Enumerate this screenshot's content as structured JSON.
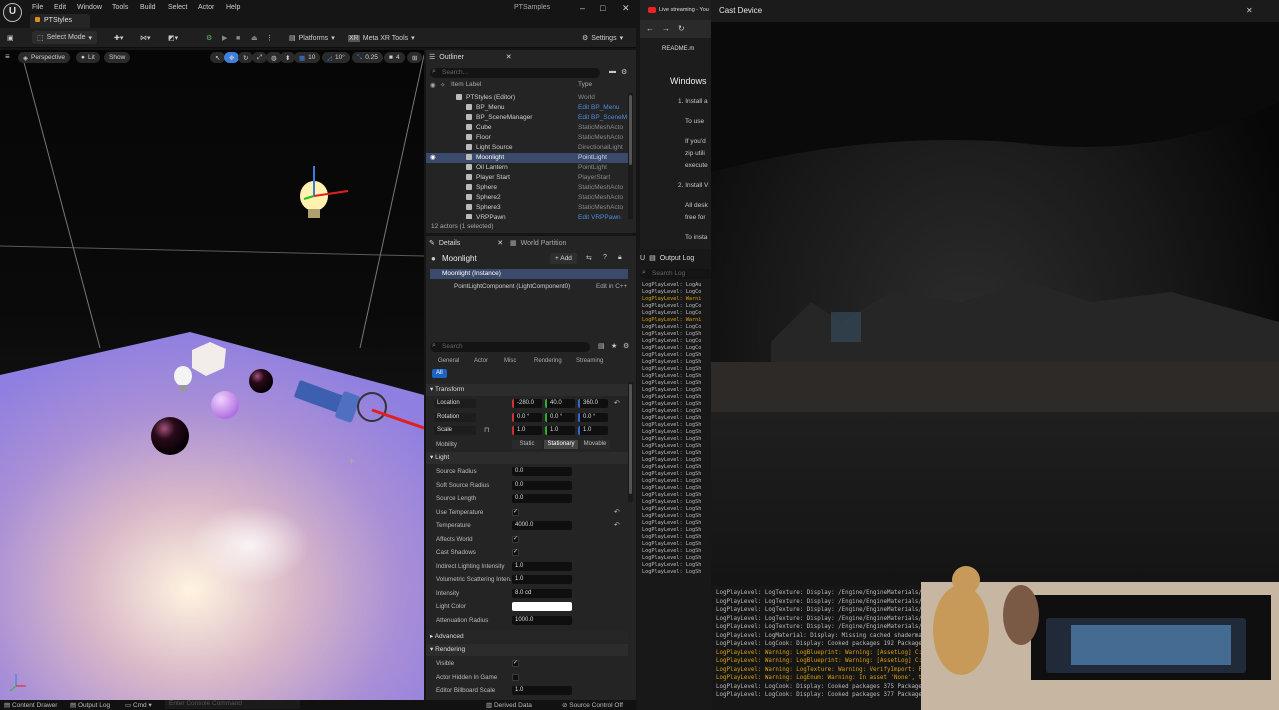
{
  "menubar": {
    "items": [
      "File",
      "Edit",
      "Window",
      "Tools",
      "Build",
      "Select",
      "Actor",
      "Help"
    ],
    "project_tab": "PTStyles",
    "window_title": "PTSamples"
  },
  "toolbar": {
    "select_mode": "Select Mode",
    "platforms": "Platforms",
    "meta_xr": "Meta XR Tools",
    "settings": "Settings"
  },
  "viewport": {
    "perspective": "Perspective",
    "lit": "Lit",
    "show": "Show",
    "grid_snap": "10",
    "rot_snap": "10°",
    "scale_snap": "0.25",
    "cam_speed": "4"
  },
  "outliner": {
    "tab": "Outliner",
    "search_placeholder": "Search...",
    "col_label": "Item Label",
    "col_type": "Type",
    "rows": [
      {
        "label": "PTStyles (Editor)",
        "type": "World",
        "link": false
      },
      {
        "label": "BP_Menu",
        "type": "Edit BP_Menu",
        "link": true
      },
      {
        "label": "BP_SceneManager",
        "type": "Edit BP_SceneM",
        "link": true
      },
      {
        "label": "Cube",
        "type": "StaticMeshActo",
        "link": false
      },
      {
        "label": "Floor",
        "type": "StaticMeshActo",
        "link": false
      },
      {
        "label": "Light Source",
        "type": "DirectionalLight",
        "link": false
      },
      {
        "label": "Moonlight",
        "type": "PointLight",
        "link": false
      },
      {
        "label": "Oil Lantern",
        "type": "PointLight",
        "link": false
      },
      {
        "label": "Player Start",
        "type": "PlayerStart",
        "link": false
      },
      {
        "label": "Sphere",
        "type": "StaticMeshActo",
        "link": false
      },
      {
        "label": "Sphere2",
        "type": "StaticMeshActo",
        "link": false
      },
      {
        "label": "Sphere3",
        "type": "StaticMeshActo",
        "link": false
      },
      {
        "label": "VRPPawn",
        "type": "Edit VRPPawn",
        "link": true
      }
    ],
    "count": "12 actors (1 selected)"
  },
  "details": {
    "tab_details": "Details",
    "tab_world_partition": "World Partition",
    "actor_name": "Moonlight",
    "add_label": "+ Add",
    "instance": "Moonlight (Instance)",
    "component": "PointLightComponent (LightComponent0)",
    "edit_cpp": "Edit in C++",
    "search_placeholder": "Search",
    "filter_tabs": [
      "General",
      "Actor",
      "Misc",
      "Rendering",
      "Streaming"
    ],
    "filter_all": "All",
    "sections": {
      "transform": "Transform",
      "light": "Light",
      "advanced": "Advanced",
      "rendering": "Rendering"
    },
    "location": {
      "label": "Location",
      "x": "-280.0",
      "y": "40.0",
      "z": "360.0"
    },
    "rotation": {
      "label": "Rotation",
      "x": "0.0 °",
      "y": "0.0 °",
      "z": "0.0 °"
    },
    "scale": {
      "label": "Scale",
      "x": "1.0",
      "y": "1.0",
      "z": "1.0"
    },
    "mobility": {
      "label": "Mobility",
      "options": [
        "Static",
        "Stationary",
        "Movable"
      ]
    },
    "light_props": [
      {
        "label": "Source Radius",
        "value": "0.0"
      },
      {
        "label": "Soft Source Radius",
        "value": "0.0"
      },
      {
        "label": "Source Length",
        "value": "0.0"
      },
      {
        "label": "Use Temperature",
        "value": "✓"
      },
      {
        "label": "Temperature",
        "value": "4000.0"
      },
      {
        "label": "Affects World",
        "value": "✓"
      },
      {
        "label": "Cast Shadows",
        "value": "✓"
      },
      {
        "label": "Indirect Lighting Intensity",
        "value": "1.0"
      },
      {
        "label": "Volumetric Scattering Inten...",
        "value": "1.0"
      },
      {
        "label": "Intensity",
        "value": "8.0 cd"
      },
      {
        "label": "Light Color",
        "value": ""
      },
      {
        "label": "Attenuation Radius",
        "value": "1000.0"
      }
    ],
    "render_props": [
      {
        "label": "Visible",
        "value": "✓"
      },
      {
        "label": "Actor Hidden In Game",
        "value": ""
      },
      {
        "label": "Editor Billboard Scale",
        "value": "1.0"
      }
    ]
  },
  "statusbar": {
    "content_drawer": "Content Drawer",
    "output_log": "Output Log",
    "cmd": "Cmd",
    "console_placeholder": "Enter Console Command",
    "derived_data": "Derived Data",
    "source_control": "Source Control Off"
  },
  "browser": {
    "tab": "Live streaming - You",
    "readme": "README.m",
    "heading": "Windows",
    "lines": [
      "1. Install a",
      "To use",
      "If you'd",
      "zip utili",
      "execute",
      "2. Install V",
      "All desk",
      "free for",
      "To insta"
    ]
  },
  "cast": {
    "title": "Cast Device"
  },
  "output_log": {
    "tab": "Output Log",
    "search_placeholder": "Search Log",
    "lines": [
      {
        "t": "LogPlayLevel: LogAu",
        "w": false
      },
      {
        "t": "LogPlayLevel: LogCo",
        "w": false
      },
      {
        "t": "LogPlayLevel: Warni",
        "w": true
      },
      {
        "t": "LogPlayLevel: LogCo",
        "w": false
      },
      {
        "t": "LogPlayLevel: LogCo",
        "w": false
      },
      {
        "t": "LogPlayLevel: Warni",
        "w": true
      },
      {
        "t": "LogPlayLevel: LogCo",
        "w": false
      },
      {
        "t": "LogPlayLevel: LogSh",
        "w": false
      },
      {
        "t": "LogPlayLevel: LogCo",
        "w": false
      },
      {
        "t": "LogPlayLevel: LogCo",
        "w": false
      },
      {
        "t": "LogPlayLevel: LogSh",
        "w": false
      },
      {
        "t": "LogPlayLevel: LogSh",
        "w": false
      },
      {
        "t": "LogPlayLevel: LogSh",
        "w": false
      },
      {
        "t": "LogPlayLevel: LogSh",
        "w": false
      },
      {
        "t": "LogPlayLevel: LogSh",
        "w": false
      },
      {
        "t": "LogPlayLevel: LogSh",
        "w": false
      },
      {
        "t": "LogPlayLevel: LogSh",
        "w": false
      },
      {
        "t": "LogPlayLevel: LogSh",
        "w": false
      },
      {
        "t": "LogPlayLevel: LogSh",
        "w": false
      },
      {
        "t": "LogPlayLevel: LogSh",
        "w": false
      },
      {
        "t": "LogPlayLevel: LogSh",
        "w": false
      },
      {
        "t": "LogPlayLevel: LogSh",
        "w": false
      },
      {
        "t": "LogPlayLevel: LogSh",
        "w": false
      },
      {
        "t": "LogPlayLevel: LogSh",
        "w": false
      },
      {
        "t": "LogPlayLevel: LogSh",
        "w": false
      },
      {
        "t": "LogPlayLevel: LogSh",
        "w": false
      },
      {
        "t": "LogPlayLevel: LogSh",
        "w": false
      },
      {
        "t": "LogPlayLevel: LogSh",
        "w": false
      },
      {
        "t": "LogPlayLevel: LogSh",
        "w": false
      },
      {
        "t": "LogPlayLevel: LogSh",
        "w": false
      },
      {
        "t": "LogPlayLevel: LogSh",
        "w": false
      },
      {
        "t": "LogPlayLevel: LogSh",
        "w": false
      },
      {
        "t": "LogPlayLevel: LogSh",
        "w": false
      },
      {
        "t": "LogPlayLevel: LogSh",
        "w": false
      },
      {
        "t": "LogPlayLevel: LogSh",
        "w": false
      },
      {
        "t": "LogPlayLevel: LogSh",
        "w": false
      },
      {
        "t": "LogPlayLevel: LogSh",
        "w": false
      },
      {
        "t": "LogPlayLevel: LogSh",
        "w": false
      },
      {
        "t": "LogPlayLevel: LogSh",
        "w": false
      },
      {
        "t": "LogPlayLevel: LogSh",
        "w": false
      },
      {
        "t": "LogPlayLevel: LogSh",
        "w": false
      },
      {
        "t": "LogPlayLevel: LogSh",
        "w": false
      }
    ],
    "bottom_lines": [
      {
        "t": "LogPlayLevel: LogTexture: Display: /Engine/EngineMaterials/BaseFlattenLine",
        "w": false
      },
      {
        "t": "LogPlayLevel: LogTexture: Display: /Engine/EngineMaterials/BaseFlatten_Gr",
        "w": false
      },
      {
        "t": "LogPlayLevel: LogTexture: Display: /Engine/EngineMaterials/BaseFlattenLin",
        "w": false
      },
      {
        "t": "LogPlayLevel: LogTexture: Display: /Engine/EngineMaterials/BaseFlattenEm",
        "w": false
      },
      {
        "t": "LogPlayLevel: LogTexture: Display: /Engine/EngineMaterials/BaseFlattenDif",
        "w": false
      },
      {
        "t": "LogPlayLevel: LogMaterial: Display: Missing cached shadermap for BasicShap",
        "w": false
      },
      {
        "t": "LogPlayLevel: LogCook: Display: Cooked packages 192 Packages Remain 184 To",
        "w": false
      },
      {
        "t": "LogPlayLevel: Warning: LogBlueprint: Warning: [AssetLog] C:\\Users\\ook\\Docu",
        "w": true
      },
      {
        "t": "LogPlayLevel: Warning: LogBlueprint: Warning: [AssetLog] C:\\Users\\ook\\Docu",
        "w": true
      },
      {
        "t": "LogPlayLevel: Warning: LogTexture: Warning: VerifyImport: Failed to find sc",
        "w": true
      },
      {
        "t": "LogPlayLevel: Warning: LogEnum: Warning: In asset 'None', there is an enum",
        "w": true
      },
      {
        "t": "LogPlayLevel: LogCook: Display: Cooked packages 375 Packages Remain 3 Total",
        "w": false
      },
      {
        "t": "LogPlayLevel: LogCook: Display: Cooked packages 377 Packages Remain 1 Total",
        "w": false
      }
    ]
  },
  "colors": {
    "accent": "#3d7fd9",
    "selection": "#3a4a6a",
    "warning": "#d8a10e",
    "link": "#4d8ee0",
    "brand_orange": "#e08a1e"
  }
}
